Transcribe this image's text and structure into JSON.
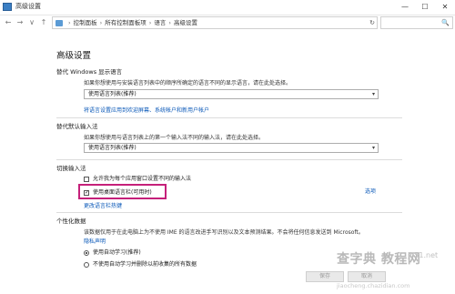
{
  "window": {
    "title": "高级设置",
    "controls": {
      "minimize": "—",
      "maximize": "☐",
      "close": "✕"
    }
  },
  "addressbar": {
    "back": "←",
    "forward": "→",
    "dropdown": "∨",
    "up": "↑",
    "path": [
      "控制面板",
      "所有控制面板项",
      "语言",
      "高级设置"
    ],
    "separator": "›",
    "refresh": "↻",
    "search_placeholder": "",
    "search_icon": "🔍"
  },
  "page": {
    "heading": "高级设置",
    "display_lang": {
      "title": "替代 Windows 显示语言",
      "desc": "如果你想使用与安装语言列表中的顺序所确定的语言不同的显示语言，请在此处选择。",
      "select_value": "使用语言列表(推荐)",
      "link": "将语言设置应用到欢迎屏幕、系统帐户和新用户帐户"
    },
    "input_method": {
      "title": "替代默认输入法",
      "desc": "如果你想使用与语言列表上的第一个输入法不同的输入法，请在此处选择。",
      "select_value": "使用语言列表(推荐)"
    },
    "switching": {
      "title": "切换输入法",
      "option1": "允许我为每个应用窗口设置不同的输入法",
      "option2": "使用桌面语言栏(可用时)",
      "option2_checkmark": "✓",
      "options_link": "选项",
      "hotkey_link": "更改语言栏热键"
    },
    "personalization": {
      "title": "个性化数据",
      "desc": "该数据仅用于在此电脑上为不使用 IME 的语言改进手写识别以及文本预测结果。不会将任何信息发送到 Microsoft。",
      "privacy_link": "隐私声明",
      "radio1": "使用自动学习(推荐)",
      "radio2": "不使用自动学习并删除以前收集的所有数据"
    },
    "buttons": {
      "save": "保存",
      "cancel": "取消"
    }
  },
  "watermark": {
    "site": "查字典 教程网",
    "url": "jiaocheng.chazidian.com",
    "tag": "jb51.net"
  }
}
